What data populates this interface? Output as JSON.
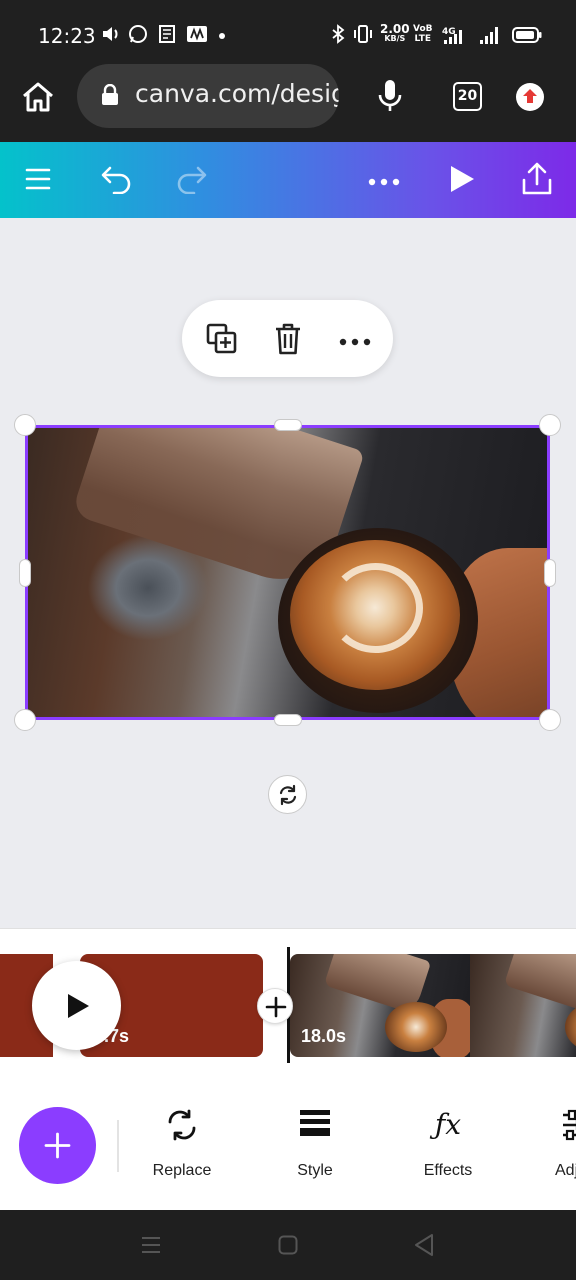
{
  "status_bar": {
    "time": "12:23",
    "net_speed_value": "2.00",
    "net_speed_unit": "KB/S",
    "volte_top": "VoB",
    "volte_bottom": "LTE",
    "network": "4G"
  },
  "browser": {
    "url": "canva.com/design",
    "tab_count": "20"
  },
  "timeline": {
    "clip1_duration": "4.7s",
    "clip2_duration": "18.0s"
  },
  "tools": [
    {
      "label": "Replace",
      "icon": "replace-icon"
    },
    {
      "label": "Style",
      "icon": "style-icon"
    },
    {
      "label": "Effects",
      "icon": "effects-icon"
    },
    {
      "label": "Adjust",
      "icon": "adjust-icon"
    }
  ],
  "colors": {
    "accent": "#8b3dff",
    "gradient_start": "#04c2cb",
    "gradient_end": "#7d2ae8",
    "clip_red": "#8a2a18"
  }
}
